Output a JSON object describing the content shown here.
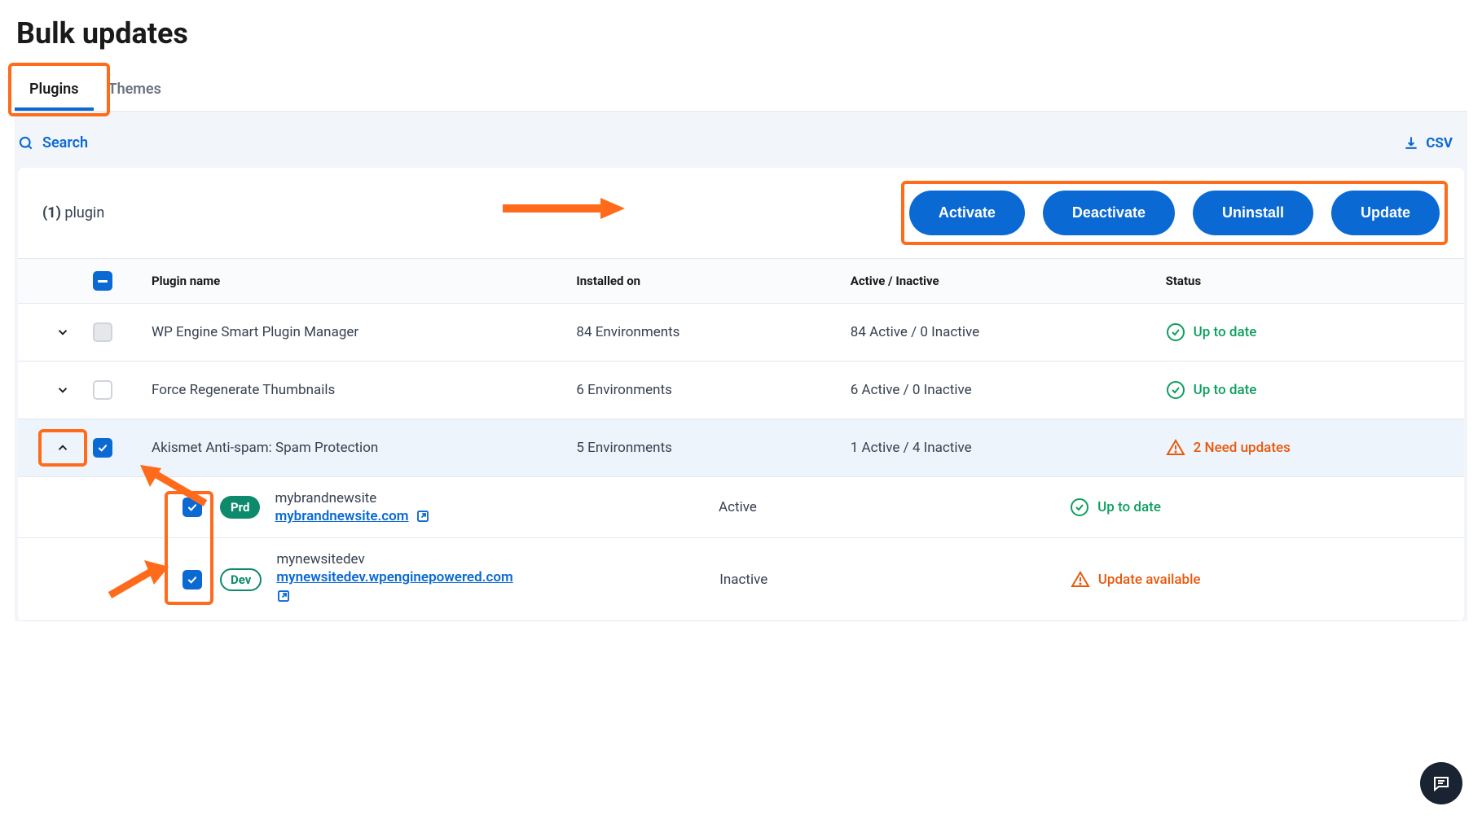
{
  "page": {
    "title": "Bulk updates"
  },
  "tabs": [
    {
      "label": "Plugins",
      "active": true
    },
    {
      "label": "Themes",
      "active": false
    }
  ],
  "toolbar": {
    "search_label": "Search",
    "csv_label": "CSV"
  },
  "selection": {
    "count_prefix": "(1)",
    "count_suffix": "plugin"
  },
  "actions": {
    "activate": "Activate",
    "deactivate": "Deactivate",
    "uninstall": "Uninstall",
    "update": "Update"
  },
  "columns": {
    "name": "Plugin name",
    "installed": "Installed on",
    "active": "Active / Inactive",
    "status": "Status"
  },
  "rows": [
    {
      "name": "WP Engine Smart Plugin Manager",
      "installed": "84 Environments",
      "active": "84 Active / 0 Inactive",
      "status_text": "Up to date",
      "status_type": "ok",
      "expanded": false,
      "checked": false,
      "check_disabled": true
    },
    {
      "name": "Force Regenerate Thumbnails",
      "installed": "6 Environments",
      "active": "6 Active / 0 Inactive",
      "status_text": "Up to date",
      "status_type": "ok",
      "expanded": false,
      "checked": false,
      "check_disabled": false
    },
    {
      "name": "Akismet Anti-spam: Spam Protection",
      "installed": "5 Environments",
      "active": "1 Active / 4 Inactive",
      "status_text": "2 Need updates",
      "status_type": "warn",
      "expanded": true,
      "checked": true,
      "check_disabled": false
    }
  ],
  "sub_rows": [
    {
      "env": "Prd",
      "env_class": "prd",
      "site_name": "mybrandnewsite",
      "site_url": "mybrandnewsite.com",
      "activity": "Active",
      "status_text": "Up to date",
      "status_type": "ok",
      "checked": true
    },
    {
      "env": "Dev",
      "env_class": "dev",
      "site_name": "mynewsitedev",
      "site_url": "mynewsitedev.wpenginepowered.com",
      "activity": "Inactive",
      "status_text": "Update available",
      "status_type": "warn",
      "checked": true
    }
  ]
}
